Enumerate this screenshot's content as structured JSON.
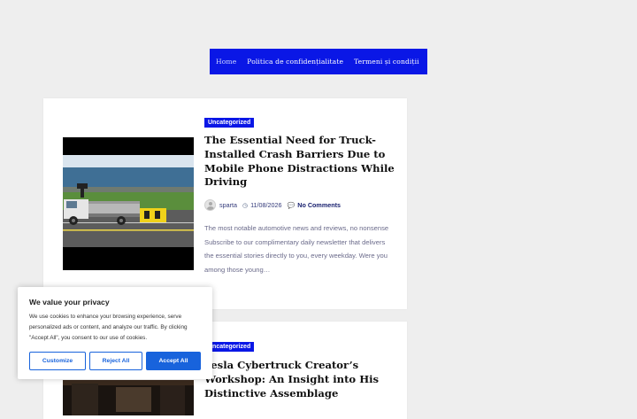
{
  "nav": {
    "items": [
      "Home",
      "Politica de confidențialitate",
      "Termeni și condiții"
    ]
  },
  "posts": [
    {
      "category": "Uncategorized",
      "title": "The Essential Need for Truck-Installed Crash Barriers Due to Mobile Phone Distractions While Driving",
      "author": "sparta",
      "date": "11/08/2026",
      "comments": "No Comments",
      "excerpt": "The most notable automotive news and reviews, no nonsense Subscribe to our complimentary daily newsletter that delivers the essential stories directly to you, every weekday. Were you among those young…"
    },
    {
      "category": "Uncategorized",
      "title": "Tesla Cybertruck Creator’s Workshop: An Insight into His Distinctive Assemblage"
    }
  ],
  "cookie": {
    "title": "We value your privacy",
    "text": "We use cookies to enhance your browsing experience, serve personalized ads or content, and analyze our traffic. By clicking \"Accept All\", you consent to our use of cookies.",
    "customize": "Customize",
    "reject": "Reject All",
    "accept": "Accept All"
  },
  "colors": {
    "nav_bg": "#0a17e6",
    "badge_bg": "#0a17e6",
    "cookie_accent": "#1863dc"
  },
  "icons": [
    "user-avatar-icon",
    "clock-icon",
    "comments-icon"
  ]
}
